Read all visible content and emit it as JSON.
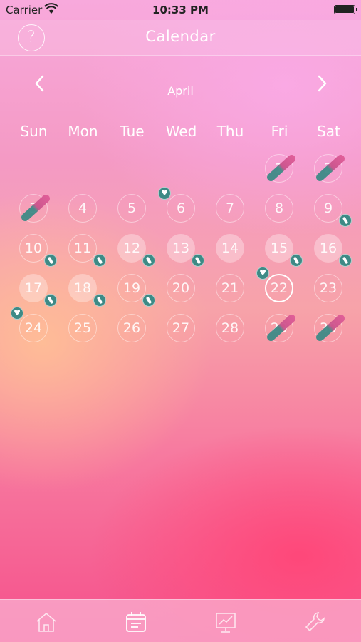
{
  "status": {
    "carrier": "Carrier",
    "time": "10:33 PM"
  },
  "nav": {
    "title": "Calendar",
    "help_label": "?"
  },
  "month": {
    "label": "April"
  },
  "weekdays": [
    "Sun",
    "Mon",
    "Tue",
    "Wed",
    "Thu",
    "Fri",
    "Sat"
  ],
  "days": [
    {
      "n": "1",
      "col": 5,
      "row": 0,
      "pen": true
    },
    {
      "n": "2",
      "col": 6,
      "row": 0,
      "pen": true
    },
    {
      "n": "3",
      "col": 0,
      "row": 1,
      "pen": true
    },
    {
      "n": "4",
      "col": 1,
      "row": 1
    },
    {
      "n": "5",
      "col": 2,
      "row": 1
    },
    {
      "n": "6",
      "col": 3,
      "row": 1,
      "heart": true
    },
    {
      "n": "7",
      "col": 4,
      "row": 1
    },
    {
      "n": "8",
      "col": 5,
      "row": 1
    },
    {
      "n": "9",
      "col": 6,
      "row": 1,
      "pill": true
    },
    {
      "n": "10",
      "col": 0,
      "row": 2,
      "pill": true
    },
    {
      "n": "11",
      "col": 1,
      "row": 2,
      "pill": true
    },
    {
      "n": "12",
      "col": 2,
      "row": 2,
      "filled": true,
      "pill": true
    },
    {
      "n": "13",
      "col": 3,
      "row": 2,
      "filled": true,
      "pill": true
    },
    {
      "n": "14",
      "col": 4,
      "row": 2,
      "filled": true
    },
    {
      "n": "15",
      "col": 5,
      "row": 2,
      "filled": true,
      "pill": true
    },
    {
      "n": "16",
      "col": 6,
      "row": 2,
      "filled": true,
      "pill": true
    },
    {
      "n": "17",
      "col": 0,
      "row": 3,
      "filled": true,
      "pill": true
    },
    {
      "n": "18",
      "col": 1,
      "row": 3,
      "filled": true,
      "pill": true
    },
    {
      "n": "19",
      "col": 2,
      "row": 3,
      "pill": true
    },
    {
      "n": "20",
      "col": 3,
      "row": 3
    },
    {
      "n": "21",
      "col": 4,
      "row": 3
    },
    {
      "n": "22",
      "col": 5,
      "row": 3,
      "today": true,
      "heart": true
    },
    {
      "n": "23",
      "col": 6,
      "row": 3
    },
    {
      "n": "24",
      "col": 0,
      "row": 4,
      "heart": true
    },
    {
      "n": "25",
      "col": 1,
      "row": 4
    },
    {
      "n": "26",
      "col": 2,
      "row": 4
    },
    {
      "n": "27",
      "col": 3,
      "row": 4
    },
    {
      "n": "28",
      "col": 4,
      "row": 4
    },
    {
      "n": "29",
      "col": 5,
      "row": 4,
      "pen": true
    },
    {
      "n": "30",
      "col": 6,
      "row": 4,
      "pen": true
    }
  ],
  "tabs": [
    {
      "name": "home",
      "icon": "home-icon"
    },
    {
      "name": "calendar",
      "icon": "calendar-icon",
      "selected": true
    },
    {
      "name": "chart",
      "icon": "chart-icon"
    },
    {
      "name": "settings",
      "icon": "wrench-icon"
    }
  ],
  "colors": {
    "badge": "#3e8a86",
    "pen_pink": "#e05b97"
  }
}
